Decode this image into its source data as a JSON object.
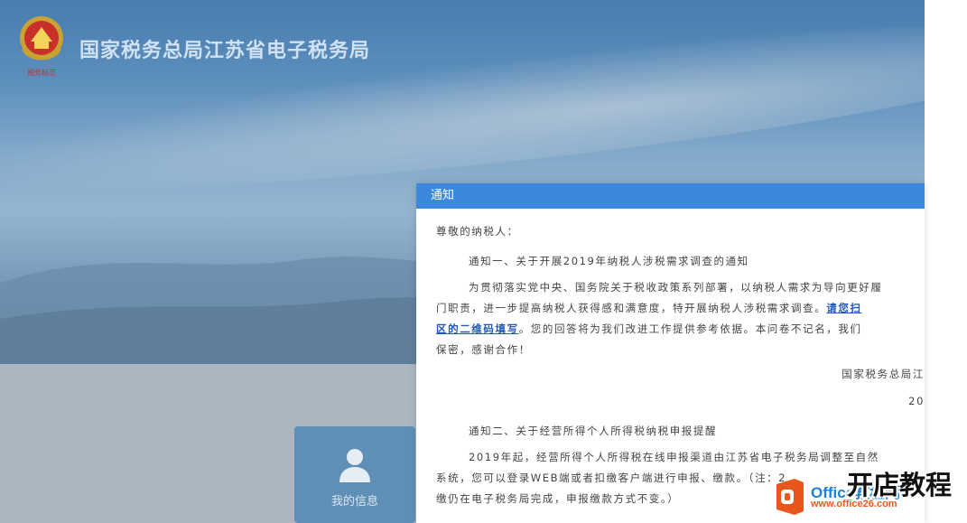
{
  "header": {
    "title": "国家税务总局江苏省电子税务局",
    "emblem_caption": "税务标志"
  },
  "tile": {
    "label": "我的信息",
    "icon": "user-icon"
  },
  "dialog": {
    "title": "通知",
    "greeting": "尊敬的纳税人：",
    "notice1": {
      "title": "通知一、关于开展2019年纳税人涉税需求调查的通知",
      "line1": "为贯彻落实党中央、国务院关于税收政策系列部署，以纳税人需求为导向更好履",
      "line2_pre": "门职责，进一步提高纳税人获得感和满意度，特开展纳税人涉税需求调查。",
      "line2_link": "请您扫",
      "line3_link": "区的二维码填写",
      "line3_post": "。您的回答将为我们改进工作提供参考依据。本问卷不记名，我们",
      "line4": "保密，感谢合作！",
      "signature": "国家税务总局江",
      "date": "20"
    },
    "notice2": {
      "title": "通知二、关于经营所得个人所得税纳税申报提醒",
      "line1": "2019年起，经营所得个人所得税在线申报渠道由江苏省电子税务局调整至自然",
      "line2": "系统，您可以登录WEB端或者扣缴客户端进行申报、缴款。（注：2",
      "line3": "缴仍在电子税务局完成，申报缴款方式不变。）"
    }
  },
  "watermark": {
    "brand": "Office教程网",
    "url": "www.office26.com",
    "overlay_text": "开店教程"
  },
  "colors": {
    "dialog_header": "#3b88dd",
    "link": "#2458b8",
    "tile": "#5f8fb7"
  }
}
